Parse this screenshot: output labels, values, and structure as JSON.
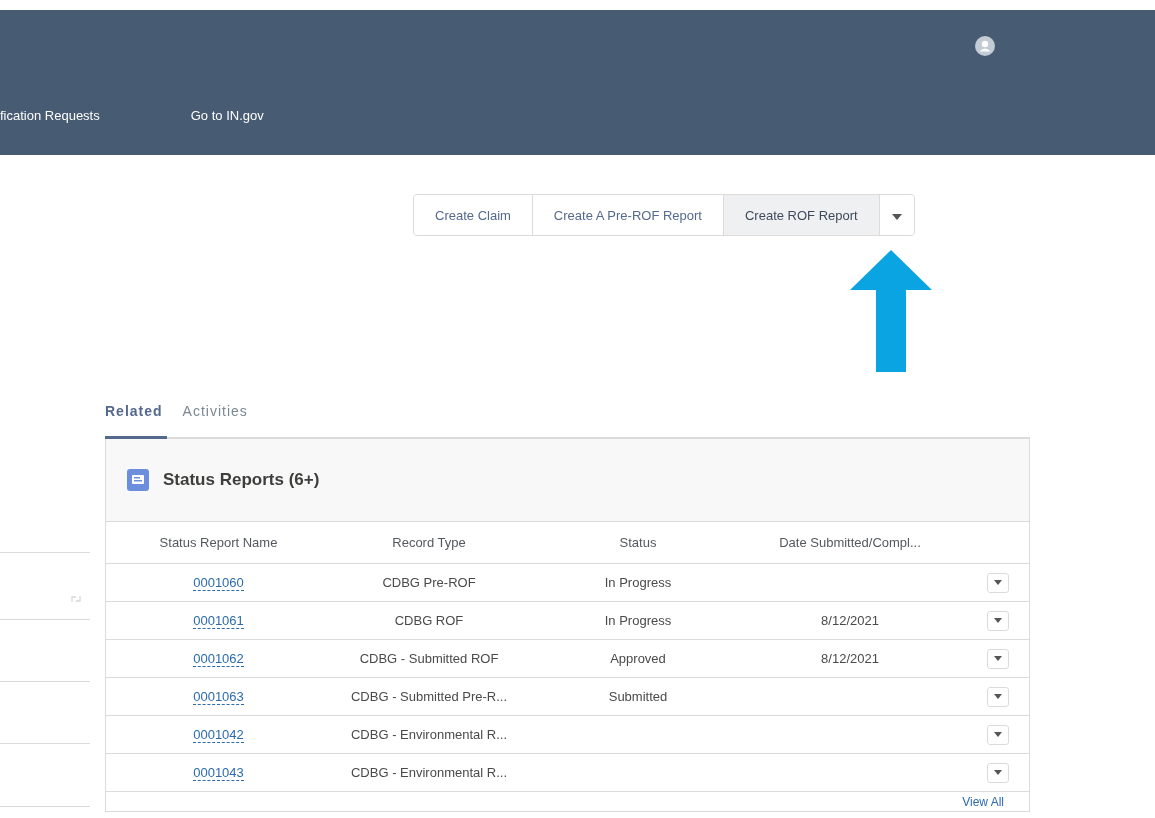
{
  "nav": [
    {
      "label": "fication Requests"
    },
    {
      "label": "Go to IN.gov"
    }
  ],
  "actions": {
    "buttons": [
      {
        "label": "Create Claim",
        "selected": false
      },
      {
        "label": "Create A Pre-ROF Report",
        "selected": false
      },
      {
        "label": "Create ROF Report",
        "selected": true
      }
    ]
  },
  "tabs": [
    {
      "label": "Related",
      "selected": true
    },
    {
      "label": "Activities",
      "selected": false
    }
  ],
  "card": {
    "title": "Status Reports (6+)",
    "columns": [
      "Status Report Name",
      "Record Type",
      "Status",
      "Date Submitted/Compl..."
    ],
    "rows": [
      {
        "name": "0001060",
        "record_type": "CDBG Pre-ROF",
        "status": "In Progress",
        "date": ""
      },
      {
        "name": "0001061",
        "record_type": "CDBG ROF",
        "status": "In Progress",
        "date": "8/12/2021"
      },
      {
        "name": "0001062",
        "record_type": "CDBG - Submitted ROF",
        "status": "Approved",
        "date": "8/12/2021"
      },
      {
        "name": "0001063",
        "record_type": "CDBG - Submitted Pre-R...",
        "status": "Submitted",
        "date": ""
      },
      {
        "name": "0001042",
        "record_type": "CDBG - Environmental R...",
        "status": "",
        "date": ""
      },
      {
        "name": "0001043",
        "record_type": "CDBG - Environmental R...",
        "status": "",
        "date": ""
      }
    ],
    "footer_link": "View All"
  }
}
